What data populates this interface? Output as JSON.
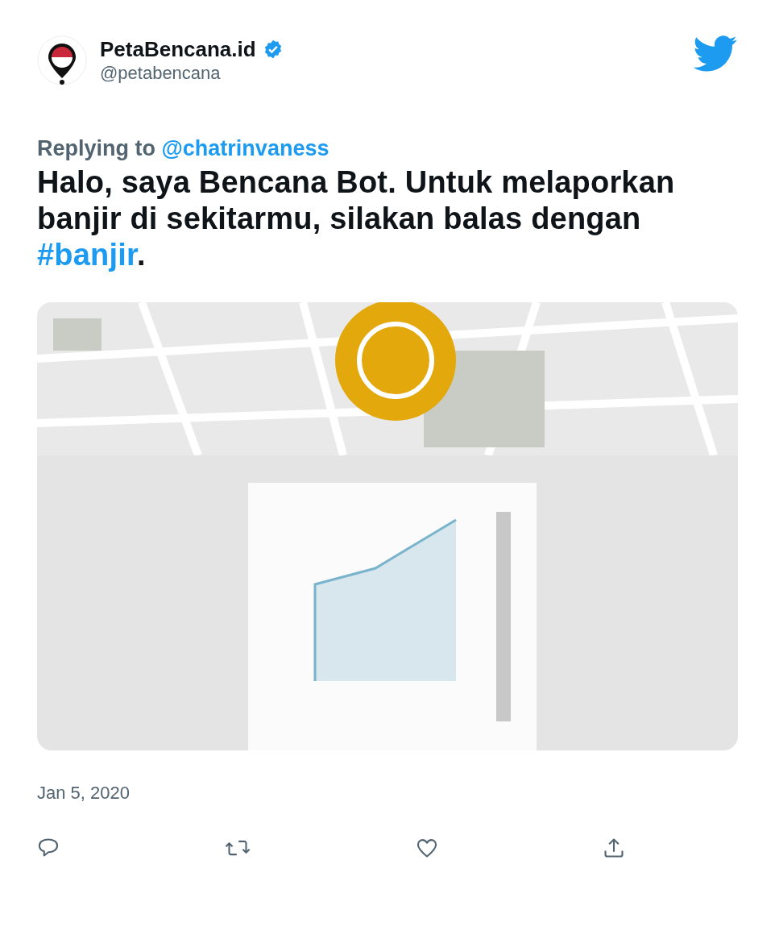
{
  "author": {
    "name": "PetaBencana.id",
    "verified": true,
    "handle": "@petabencana"
  },
  "reply": {
    "label": "Replying to",
    "to": "@chatrinvaness"
  },
  "text": {
    "before": "Halo, saya Bencana Bot. Untuk melaporkan banjir di sekitarmu, silakan balas dengan ",
    "hashtag": "#banjir",
    "after": "."
  },
  "date": "Jan 5, 2020"
}
